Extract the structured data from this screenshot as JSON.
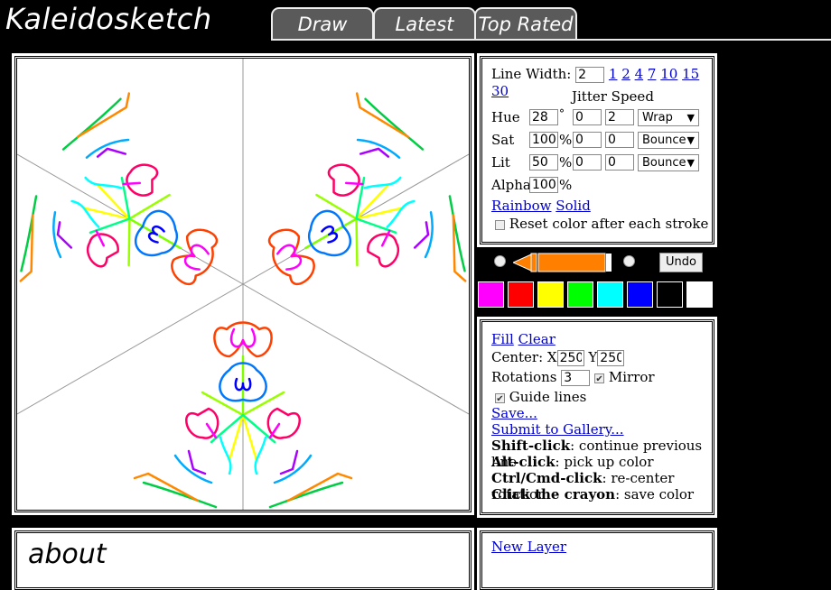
{
  "header": {
    "logo": "Kaleidosketch",
    "tabs": [
      {
        "label": "Draw"
      },
      {
        "label": "Latest"
      },
      {
        "label": "Top Rated"
      }
    ]
  },
  "line_width": {
    "label": "Line Width:",
    "value": "2",
    "presets": [
      "1",
      "2",
      "4",
      "7",
      "10",
      "15",
      "30"
    ]
  },
  "color_controls": {
    "jitter_header": "Jitter Speed",
    "hue": {
      "label": "Hue",
      "value": "28",
      "unit": "°",
      "jitter": "0",
      "speed": "2",
      "mode": "Wrap"
    },
    "sat": {
      "label": "Sat",
      "value": "100",
      "unit": "%",
      "jitter": "0",
      "speed": "0",
      "mode": "Bounce"
    },
    "lit": {
      "label": "Lit",
      "value": "50",
      "unit": "%",
      "jitter": "0",
      "speed": "0",
      "mode": "Bounce"
    },
    "alpha": {
      "label": "Alpha",
      "value": "100",
      "unit": "%"
    },
    "rainbow": "Rainbow",
    "solid": "Solid",
    "reset_label": "Reset color after each stroke"
  },
  "brush": {
    "undo": "Undo",
    "crayon_color": "#ff7f00"
  },
  "palette": [
    "#ff00ff",
    "#ff0000",
    "#ffff00",
    "#00ff00",
    "#00ffff",
    "#0000ff",
    "#000000",
    "#ffffff"
  ],
  "tools": {
    "fill": "Fill",
    "clear": "Clear",
    "center_label": "Center: X",
    "center_x": "250",
    "y_label": "Y",
    "center_y": "250",
    "rotations_label": "Rotations",
    "rotations": "3",
    "mirror_label": "Mirror",
    "guide_label": "Guide lines",
    "save": "Save...",
    "submit": "Submit to Gallery...",
    "help": [
      {
        "key": "Shift-click",
        "text": ": continue previous line"
      },
      {
        "key": "Alt-click",
        "text": ": pick up color"
      },
      {
        "key": "Ctrl/Cmd-click",
        "text": ": re-center rotation"
      },
      {
        "key": "Click the crayon",
        "text": ": save color"
      }
    ]
  },
  "about": {
    "title": "about"
  },
  "layers": {
    "new_layer": "New Layer"
  }
}
